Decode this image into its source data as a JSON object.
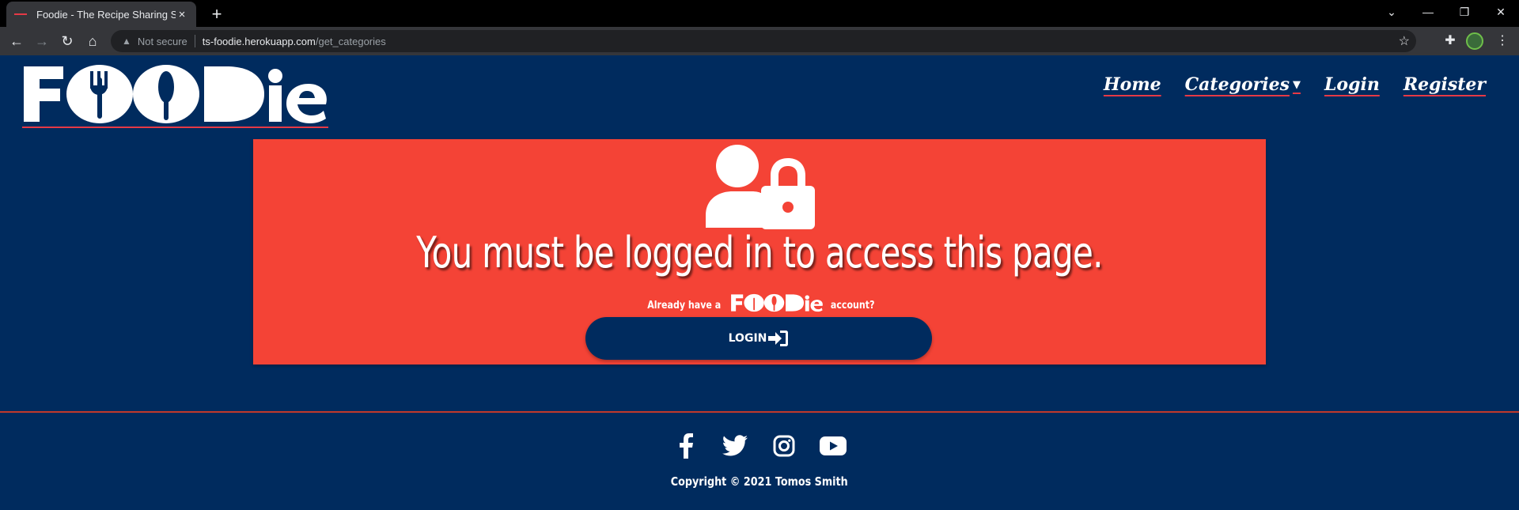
{
  "browser": {
    "tab_title": "Foodie - The Recipe Sharing Site",
    "tab_close": "×",
    "new_tab": "+",
    "not_secure": "Not secure",
    "url_host": "ts-foodie.herokuapp.com",
    "url_path": "/get_categories",
    "controls": {
      "dropdown": "⌄",
      "minimize": "—",
      "restore": "❐",
      "close": "✕"
    }
  },
  "site": {
    "logo_text": "FOODie",
    "nav": [
      {
        "label": "Home"
      },
      {
        "label": "Categories",
        "has_dropdown": true
      },
      {
        "label": "Login"
      },
      {
        "label": "Register"
      }
    ]
  },
  "panel": {
    "icon": "user-lock-icon",
    "headline": "You must be logged in to access this page.",
    "already_prefix": "Already have a",
    "already_suffix": "account?",
    "login_label": "LOGIN",
    "login_icon": "sign-in-icon"
  },
  "footer": {
    "socials": [
      "facebook-icon",
      "twitter-icon",
      "instagram-icon",
      "youtube-icon"
    ],
    "copyright": "Copyright © 2021 Tomos Smith"
  },
  "colors": {
    "page_bg": "#002b5e",
    "panel_bg": "#f44336",
    "accent": "#e63946"
  }
}
